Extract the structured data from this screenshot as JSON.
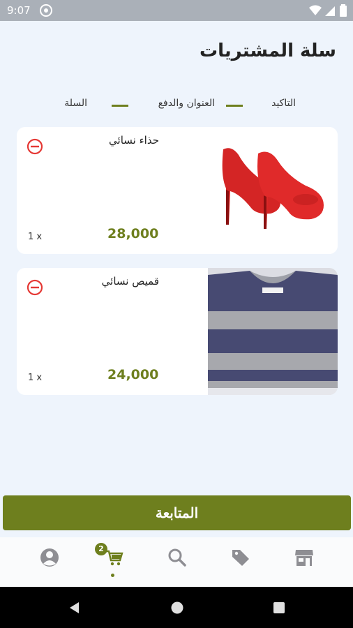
{
  "status_bar": {
    "time": "9:07"
  },
  "header": {
    "title": "سلة المشتريات"
  },
  "steps": [
    {
      "label": "التاكيد"
    },
    {
      "label": "العنوان والدفع"
    },
    {
      "label": "السلة"
    }
  ],
  "cart_items": [
    {
      "name": "حذاء نسائي",
      "price": "28,000",
      "quantity": "1 x",
      "image_icon": "red-heels-image"
    },
    {
      "name": "قميص نسائي",
      "price": "24,000",
      "quantity": "1 x",
      "image_icon": "striped-sweater-image"
    }
  ],
  "continue_button": {
    "label": "المتابعة"
  },
  "bottom_nav": {
    "items": [
      "profile-icon",
      "cart-icon",
      "search-icon",
      "tag-icon",
      "store-icon"
    ],
    "cart_badge": "2",
    "active": "cart"
  },
  "colors": {
    "accent": "#6e7f1e",
    "danger": "#e53935",
    "background": "#eef4fc"
  }
}
